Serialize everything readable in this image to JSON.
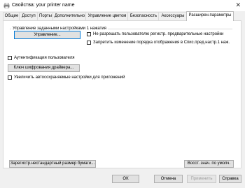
{
  "window": {
    "title": "Свойства: your printer name",
    "close_glyph": "✕"
  },
  "tabs": [
    {
      "label": "Общие"
    },
    {
      "label": "Доступ"
    },
    {
      "label": "Порты"
    },
    {
      "label": "Дополнительно"
    },
    {
      "label": "Управление цветом"
    },
    {
      "label": "Безопасность"
    },
    {
      "label": "Аксессуары"
    },
    {
      "label": "Расширен.параметры",
      "active": true
    }
  ],
  "group": {
    "title": "Управление заданными настройками 1 нажатия",
    "manage_button": "Управление...",
    "checkbox_no_user_register": "Не разрешать пользователю регистр. предварительные настройки",
    "checkbox_lock_order": "Запретить изменение порядка отображения в Спис.пред.настр.1 наж."
  },
  "user_auth_checkbox": "Аутентификация пользователя",
  "driver_key_button": "Ключ шифрования драйвера...",
  "auto_save_checkbox": "Увеличить автосохраняемые настройки для приложений",
  "custom_paper_button": "Зарегистр.нестандартный размер бумаги...",
  "restore_defaults_button": "Восст. знач. по умолч.",
  "footer": {
    "ok": "ОК",
    "cancel": "Отмена",
    "apply": "Применить",
    "help": "Справка"
  }
}
